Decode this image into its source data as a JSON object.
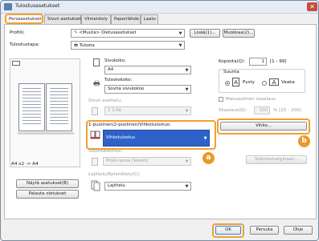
{
  "window": {
    "title": "Tulostusasetukset",
    "close": "✕"
  },
  "tabs": [
    {
      "label": "Perusasetukset"
    },
    {
      "label": "Sivun asetukset"
    },
    {
      "label": "Viimeistely"
    },
    {
      "label": "Paperilähde"
    },
    {
      "label": "Laatu"
    }
  ],
  "profile": {
    "label": "Profiili:",
    "value": "<Muuta> Oletusasetukset",
    "add_button": "Lisää(1)...",
    "edit_button": "Muokkaa(2)..."
  },
  "output_method": {
    "label": "Tulostustapa:",
    "value": "Tulosta"
  },
  "preview": {
    "caption": "A4 x2 -> A4"
  },
  "page_size": {
    "label": "Sivukoko:",
    "value": "A4"
  },
  "output_size": {
    "label": "Tulostekoko:",
    "value": "Sovita sivukokoo"
  },
  "pages_per_sheet": {
    "label": "Sivun asettelu:",
    "value": "1 1:llä"
  },
  "copies": {
    "label": "Kopioita(Q):",
    "value": "1",
    "range": "[1 - 99]"
  },
  "orientation": {
    "label": "Suunta",
    "options": [
      {
        "label": "Pysty",
        "selected": true
      },
      {
        "label": "Vaaka",
        "selected": false
      }
    ]
  },
  "manual_scaling": {
    "label": "Manuaalinen skaalaus",
    "scaling_label": "Skaalaus(G):",
    "scaling_value": "100",
    "scaling_range": "% [25 - 200]"
  },
  "duplex": {
    "label": "1-puolinen/2-puolinen/Vihkotulostus:",
    "value": "Vihkotulostus",
    "booklet_button": "Vihko..."
  },
  "binding_location": {
    "label": "Sidontareunus:",
    "value": "Pitkä reuna [Vasen]"
  },
  "binding_margin_button": "Sidontamarginaali...",
  "stapling": {
    "label": "Lajittelu/Ryhmittely(C):",
    "value": "Lajittelu"
  },
  "footer_buttons": {
    "show_settings": "Näytä asetukset(B)",
    "restore_defaults": "Palauta oletukset",
    "ok": "OK",
    "cancel": "Peruuta",
    "help": "Ohje"
  },
  "callouts": {
    "a": "a",
    "b": "b"
  },
  "colors": {
    "accent_orange": "#f0a030",
    "selection_blue": "#2f62c9",
    "badge": "#e99a2a"
  },
  "icons": [
    "printer-icon",
    "page-icon",
    "booklet-icon",
    "stapling-icon",
    "pencil-icon",
    "close-icon"
  ]
}
